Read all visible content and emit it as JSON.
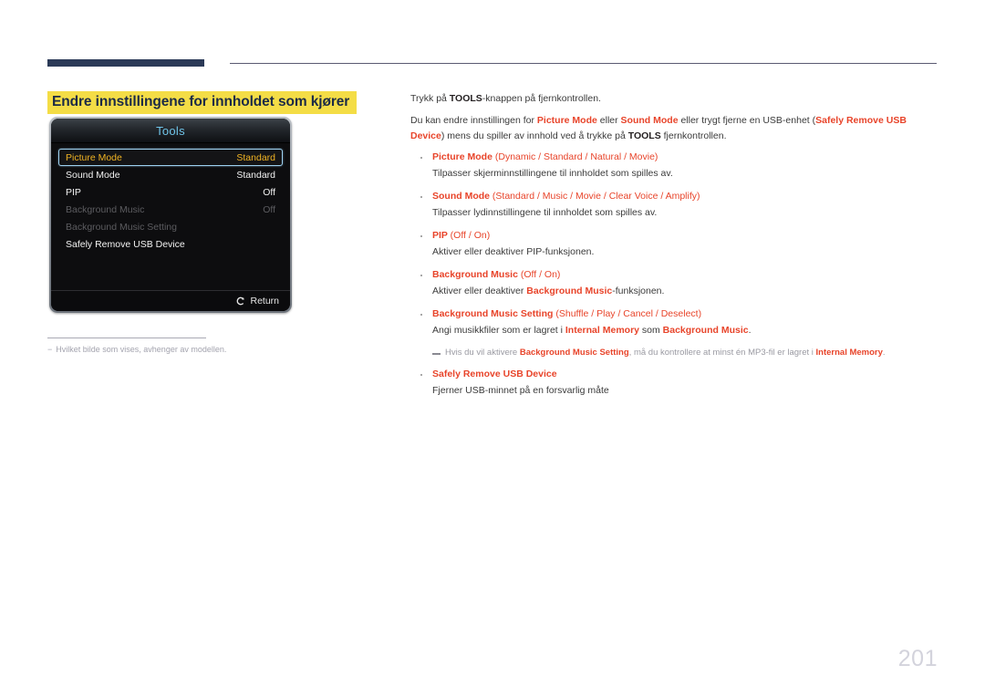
{
  "page": {
    "number": "201"
  },
  "section": {
    "title": "Endre innstillingene for innholdet som kjører",
    "highlight_color": "#f4dd46",
    "title_color": "#1b2a46"
  },
  "accent_color": "#e8442a",
  "tv_menu": {
    "header_title": "Tools",
    "rows": [
      {
        "label": "Picture Mode",
        "value": "Standard",
        "state": "selected"
      },
      {
        "label": "Sound Mode",
        "value": "Standard",
        "state": "normal"
      },
      {
        "label": "PIP",
        "value": "Off",
        "state": "normal"
      },
      {
        "label": "Background Music",
        "value": "Off",
        "state": "disabled"
      },
      {
        "label": "Background Music Setting",
        "value": "",
        "state": "disabled"
      },
      {
        "label": "Safely Remove USB Device",
        "value": "",
        "state": "normal"
      }
    ],
    "footer": {
      "icon": "return-arrow-icon",
      "label": "Return"
    }
  },
  "footnote": {
    "dash": "−",
    "text": "Hvilket bilde som vises, avhenger av modellen."
  },
  "content": {
    "paragraph_1": {
      "pre": "Trykk på ",
      "bold": "TOOLS",
      "post": "-knappen på fjernkontrollen."
    },
    "paragraph_2": {
      "p1": "Du kan endre innstillingen for ",
      "a1": "Picture Mode",
      "p2": " eller ",
      "a2": "Sound Mode",
      "p3": " eller trygt fjerne en USB-enhet (",
      "a3": "Safely Remove USB Device",
      "p4": ") mens du spiller av innhold ved å trykke på ",
      "b1": "TOOLS",
      "p5": " fjernkontrollen."
    },
    "bullets": [
      {
        "name": "Picture Mode",
        "options": "(Dynamic / Standard / Natural / Movie)",
        "desc": "Tilpasser skjerminnstillingene til innholdet som spilles av."
      },
      {
        "name": "Sound Mode",
        "options": "(Standard / Music / Movie / Clear Voice / Amplify)",
        "desc": "Tilpasser lydinnstillingene til innholdet som spilles av."
      },
      {
        "name": "PIP",
        "options": "(Off / On)",
        "desc": "Aktiver eller deaktiver PIP-funksjonen."
      },
      {
        "name": "Background Music",
        "options": "(Off / On)",
        "desc_pre": "Aktiver eller deaktiver ",
        "desc_acc": "Background Music",
        "desc_post": "-funksjonen."
      },
      {
        "name": "Background Music Setting",
        "options": "(Shuffle / Play / Cancel / Deselect)",
        "desc_pre": "Angi musikkfiler som er lagret i ",
        "desc_acc1": "Internal Memory",
        "desc_mid": " som ",
        "desc_acc2": "Background Music",
        "desc_post": "."
      },
      {
        "name": "Safely Remove USB Device",
        "options": "",
        "desc": "Fjerner USB-minnet på en forsvarlig måte"
      }
    ],
    "note": {
      "p1": "Hvis du vil aktivere ",
      "a1": "Background Music Setting",
      "p2": ", må du kontrollere at minst én MP3-fil er lagret i ",
      "a2": "Internal Memory",
      "p3": "."
    }
  }
}
